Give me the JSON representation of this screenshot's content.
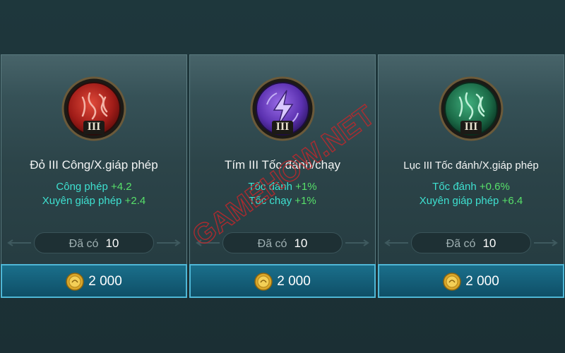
{
  "shop": {
    "owned_label": "Đã có",
    "cards": [
      {
        "color": "#b8231f",
        "emblem": "red-rune-emblem",
        "tier": "III",
        "title": "Đỏ III Công/X.giáp phép",
        "stats": [
          {
            "name": "Công phép",
            "value": "+4.2"
          },
          {
            "name": "Xuyên giáp phép",
            "value": "+2.4"
          }
        ],
        "owned": "10",
        "price": "2 000"
      },
      {
        "color": "#6b3fc4",
        "emblem": "purple-rune-emblem",
        "tier": "III",
        "title": "Tím III Tốc đánh/chạy",
        "stats": [
          {
            "name": "Tốc đánh",
            "value": "+1%"
          },
          {
            "name": "Tốc chạy",
            "value": "+1%"
          }
        ],
        "owned": "10",
        "price": "2 000"
      },
      {
        "color": "#1f7a52",
        "emblem": "green-rune-emblem",
        "tier": "III",
        "title": "Lục III Tốc đánh/X.giáp phép",
        "stats": [
          {
            "name": "Tốc đánh",
            "value": "+0.6%"
          },
          {
            "name": "Xuyên giáp phép",
            "value": "+6.4"
          }
        ],
        "owned": "10",
        "price": "2 000"
      }
    ]
  },
  "watermark": "GAMEHOW.NET"
}
